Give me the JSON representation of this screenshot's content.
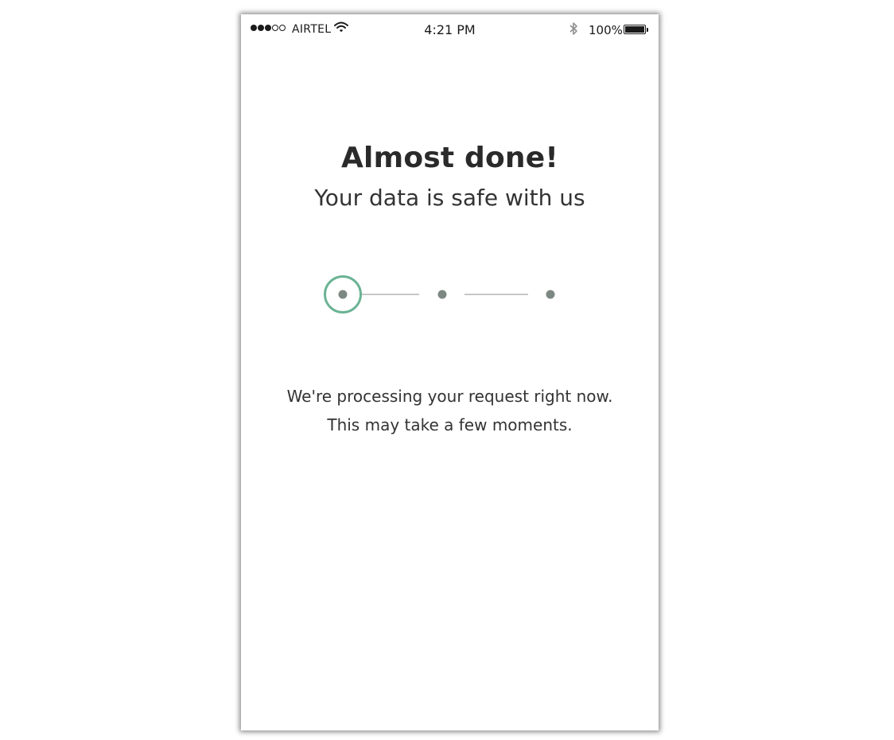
{
  "status_bar": {
    "carrier": "AIRTEL",
    "time": "4:21 PM",
    "battery": "100%",
    "signal_bars_filled": 3,
    "signal_bars_total": 5,
    "icons": [
      "wifi-icon",
      "bluetooth-icon",
      "battery-icon"
    ]
  },
  "main": {
    "title": "Almost done!",
    "subtitle": "Your data is safe with us",
    "progress": {
      "current_step": 1,
      "total_steps": 3
    },
    "message_line1": "We're processing your request right now.",
    "message_line2": "This may take a few moments."
  },
  "colors": {
    "accent": "#6ab394",
    "step_dot": "#7e8882",
    "connector": "#c6c6c6",
    "text": "#2a2a2a"
  }
}
